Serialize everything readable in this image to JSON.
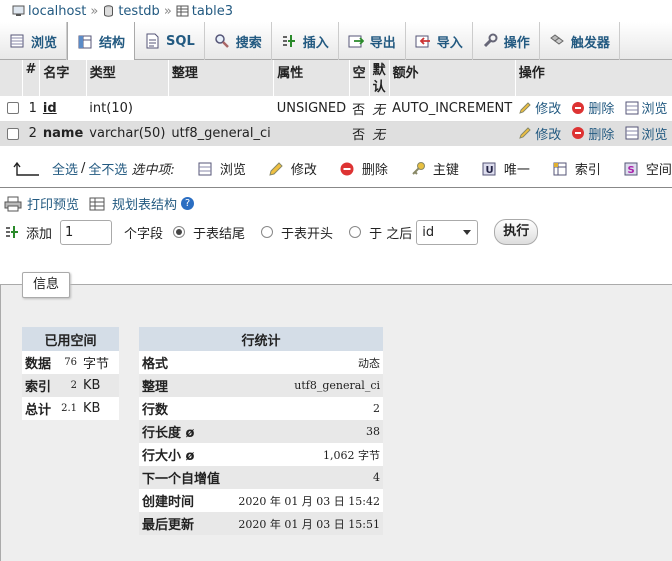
{
  "breadcrumb": {
    "server": "localhost",
    "database": "testdb",
    "table": "table3",
    "separator": "»"
  },
  "tabs": [
    {
      "label": "浏览"
    },
    {
      "label": "结构"
    },
    {
      "label": "SQL"
    },
    {
      "label": "搜索"
    },
    {
      "label": "插入"
    },
    {
      "label": "导出"
    },
    {
      "label": "导入"
    },
    {
      "label": "操作"
    },
    {
      "label": "触发器"
    }
  ],
  "structure": {
    "headers": [
      "#",
      "名字",
      "类型",
      "整理",
      "属性",
      "空",
      "默认",
      "额外",
      "操作"
    ],
    "rows": [
      {
        "num": "1",
        "name": "id",
        "type": "int(10)",
        "collation": "",
        "attributes": "UNSIGNED",
        "null": "否",
        "default": "无",
        "extra": "AUTO_INCREMENT"
      },
      {
        "num": "2",
        "name": "name",
        "type": "varchar(50)",
        "collation": "utf8_general_ci",
        "attributes": "",
        "null": "否",
        "default": "无",
        "extra": ""
      }
    ],
    "actions": {
      "edit": "修改",
      "drop": "删除",
      "browse": "浏览"
    }
  },
  "bulk": {
    "select_all": "全选",
    "divider": "/",
    "deselect_all": "全不选",
    "with_selected": "选中项:",
    "items": [
      "浏览",
      "修改",
      "删除",
      "主键",
      "唯一",
      "索引",
      "空间"
    ]
  },
  "tools": {
    "print_view": "打印预览",
    "propose_structure": "规划表结构",
    "help": "?"
  },
  "add_field": {
    "add_label": "添加",
    "count": "1",
    "fields_label": "个字段",
    "options": [
      "于表结尾",
      "于表开头",
      "于 之后"
    ],
    "after_field": "id",
    "go_label": "执行"
  },
  "info": {
    "legend": "信息",
    "space": {
      "header": "已用空间",
      "rows": [
        {
          "label": "数据",
          "value": "76",
          "unit": "字节"
        },
        {
          "label": "索引",
          "value": "2",
          "unit": "KB"
        },
        {
          "label": "总计",
          "value": "2.1",
          "unit": "KB"
        }
      ]
    },
    "row_stats": {
      "header": "行统计",
      "rows": [
        {
          "label": "格式",
          "value": "动态"
        },
        {
          "label": "整理",
          "value": "utf8_general_ci"
        },
        {
          "label": "行数",
          "value": "2"
        },
        {
          "label": "行长度 ø",
          "value": "38"
        },
        {
          "label": "行大小 ø",
          "value": "1,062 字节"
        },
        {
          "label": "下一个自增值",
          "value": "4"
        },
        {
          "label": "创建时间",
          "value": "2020 年 01 月 03 日 15:42"
        },
        {
          "label": "最后更新",
          "value": "2020 年 01 月 03 日 15:51"
        }
      ]
    }
  }
}
